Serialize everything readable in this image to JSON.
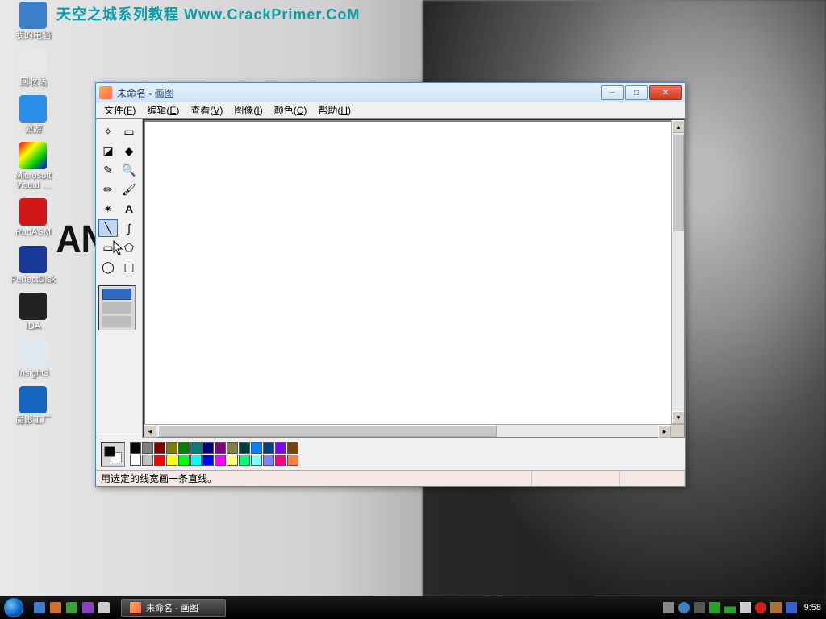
{
  "watermark": "天空之城系列教程 Www.CrackPrimer.CoM",
  "desktop_icons": [
    {
      "label": "我的电脑",
      "color": "#3a7fc8"
    },
    {
      "label": "回收站",
      "color": "#e8e8e8"
    },
    {
      "label": "傲游",
      "color": "#2a8de8"
    },
    {
      "label": "Microsoft Visual …",
      "color": "linear-gradient(135deg,#f00,#ff0,#0c0,#00f)"
    },
    {
      "label": "RadASM",
      "color": "#d01818"
    },
    {
      "label": "PerfectDisk",
      "color": "#1a3a9a"
    },
    {
      "label": "IDA",
      "color": "#222"
    },
    {
      "label": "Insight3",
      "color": "#e0e8f0"
    },
    {
      "label": "魔影工厂",
      "color": "#1566c0"
    }
  ],
  "paint": {
    "title": "未命名 - 画图",
    "menus": [
      {
        "label": "文件",
        "key": "F"
      },
      {
        "label": "编辑",
        "key": "E"
      },
      {
        "label": "查看",
        "key": "V"
      },
      {
        "label": "图像",
        "key": "I"
      },
      {
        "label": "颜色",
        "key": "C"
      },
      {
        "label": "帮助",
        "key": "H"
      }
    ],
    "tools": [
      {
        "name": "free-select",
        "glyph": "✧"
      },
      {
        "name": "rect-select",
        "glyph": "▭"
      },
      {
        "name": "eraser",
        "glyph": "◪"
      },
      {
        "name": "fill",
        "glyph": "◆"
      },
      {
        "name": "picker",
        "glyph": "✎"
      },
      {
        "name": "magnifier",
        "glyph": "🔍"
      },
      {
        "name": "pencil",
        "glyph": "✏"
      },
      {
        "name": "brush",
        "glyph": "🖌"
      },
      {
        "name": "airbrush",
        "glyph": "✴"
      },
      {
        "name": "text",
        "glyph": "A"
      },
      {
        "name": "line",
        "glyph": "╲",
        "selected": true
      },
      {
        "name": "curve",
        "glyph": "∫"
      },
      {
        "name": "rectangle",
        "glyph": "▭"
      },
      {
        "name": "polygon",
        "glyph": "⬠"
      },
      {
        "name": "ellipse",
        "glyph": "◯"
      },
      {
        "name": "rounded-rect",
        "glyph": "▢"
      }
    ],
    "palette_row1": [
      "#000000",
      "#808080",
      "#800000",
      "#808000",
      "#008000",
      "#008080",
      "#000080",
      "#800080",
      "#808040",
      "#004040",
      "#0080ff",
      "#004080",
      "#8000ff",
      "#804000"
    ],
    "palette_row2": [
      "#ffffff",
      "#c0c0c0",
      "#ff0000",
      "#ffff00",
      "#00ff00",
      "#00ffff",
      "#0000ff",
      "#ff00ff",
      "#ffff80",
      "#00ff80",
      "#80ffff",
      "#8080ff",
      "#ff0080",
      "#ff8040"
    ],
    "status": "用选定的线宽画一条直线。"
  },
  "taskbar": {
    "task_label": "未命名 - 画图",
    "clock": "9:58"
  },
  "graffiti": "AN"
}
